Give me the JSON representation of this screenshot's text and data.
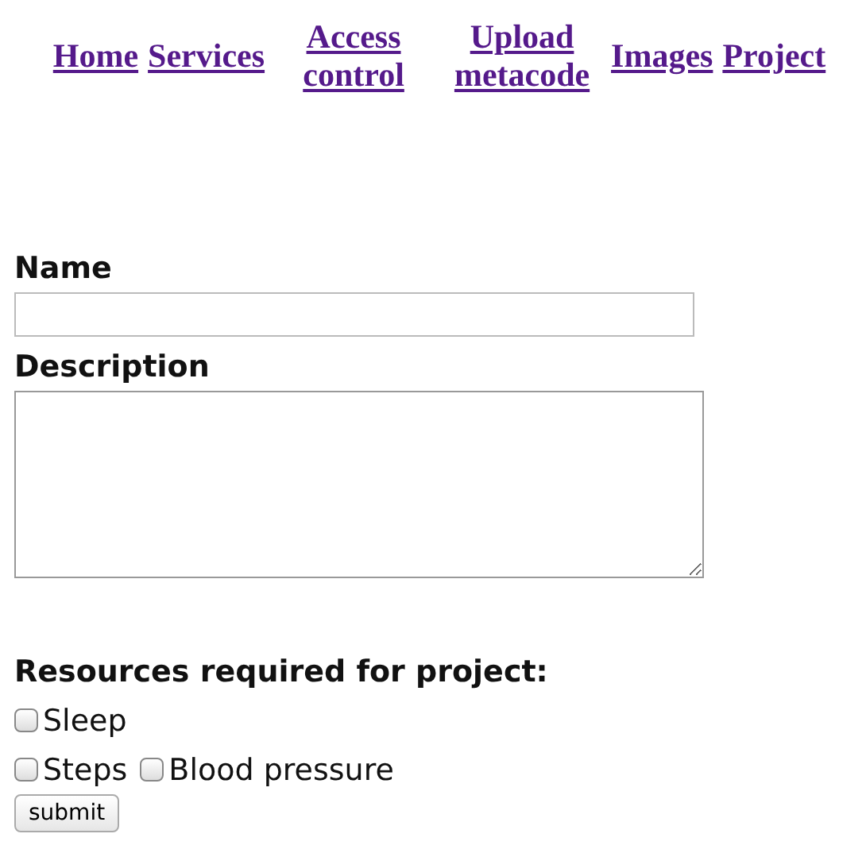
{
  "nav": {
    "links": [
      {
        "label": "Home"
      },
      {
        "label": "Services"
      },
      {
        "label": "Access control"
      },
      {
        "label": "Upload metacode"
      },
      {
        "label": "Images"
      },
      {
        "label": "Project"
      }
    ]
  },
  "form": {
    "name_label": "Name",
    "description_label": "Description",
    "resources_label": "Resources required for project:",
    "resource_rows": [
      [
        {
          "label": "Sleep",
          "checked": false
        }
      ],
      [
        {
          "label": "Steps",
          "checked": false
        },
        {
          "label": "Blood pressure",
          "checked": false
        }
      ]
    ],
    "submit": "submit"
  }
}
